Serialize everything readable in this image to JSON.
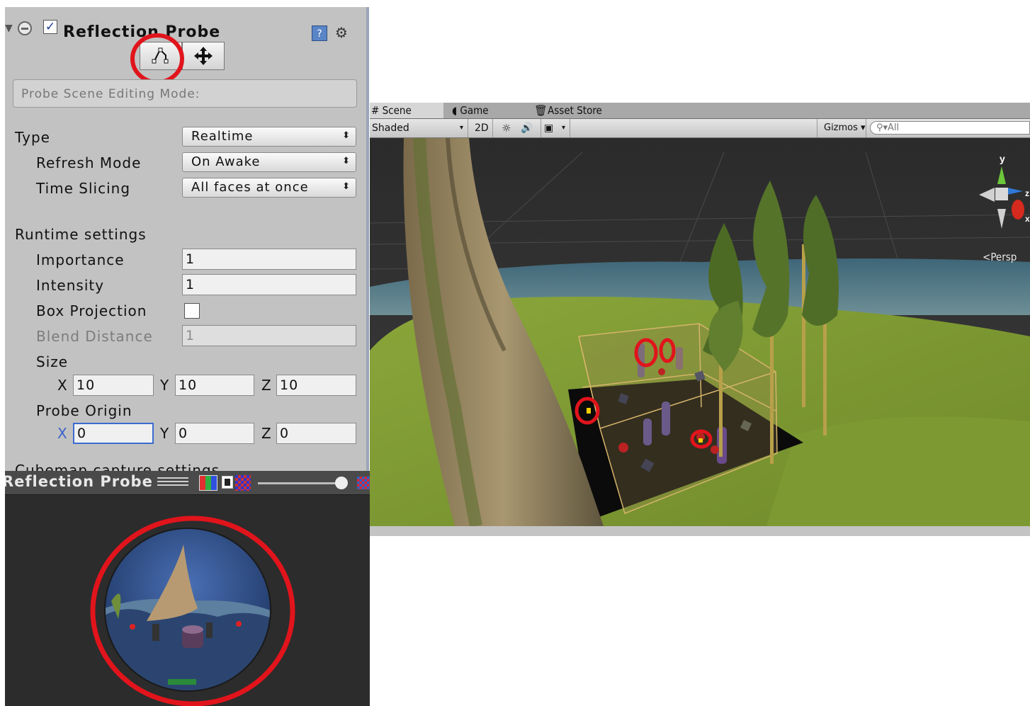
{
  "inspector": {
    "component_title": "Reflection Probe",
    "component_enabled": true,
    "edit_bounds_icon": "edit-bounds-icon",
    "move_origin_icon": "move-origin-icon",
    "mode_hint": "Probe Scene Editing Mode:",
    "type_label": "Type",
    "type_value": "Realtime",
    "refresh_mode_label": "Refresh Mode",
    "refresh_mode_value": "On Awake",
    "time_slicing_label": "Time Slicing",
    "time_slicing_value": "All faces at once",
    "runtime_settings_label": "Runtime settings",
    "importance_label": "Importance",
    "importance_value": "1",
    "intensity_label": "Intensity",
    "intensity_value": "1",
    "box_projection_label": "Box Projection",
    "box_projection_checked": false,
    "blend_distance_label": "Blend Distance",
    "blend_distance_value": "1",
    "size_label": "Size",
    "size": {
      "x_label": "X",
      "x": "10",
      "y_label": "Y",
      "y": "10",
      "z_label": "Z",
      "z": "10"
    },
    "probe_origin_label": "Probe Origin",
    "probe_origin": {
      "x_label": "X",
      "x": "0",
      "y_label": "Y",
      "y": "0",
      "z_label": "Z",
      "z": "0"
    },
    "cutoff_label": "Cubemap capture settings"
  },
  "preview": {
    "title": "Reflection Probe"
  },
  "scene": {
    "tabs": [
      {
        "icon": "grid-icon",
        "label": "Scene",
        "active": true
      },
      {
        "icon": "pacman-icon",
        "label": "Game",
        "active": false
      },
      {
        "icon": "store-icon",
        "label": "Asset Store",
        "active": false
      }
    ],
    "shading_mode": "Shaded",
    "toggle_2d": "2D",
    "gizmos_label": "Gizmos",
    "search_placeholder": "All",
    "axis_y": "y",
    "axis_z": "z",
    "axis_x": "x",
    "projection_label": "Persp"
  },
  "colors": {
    "annotation_red": "#e1141c",
    "editor_gray": "#c2c2c2",
    "probe_box": "#d6b46a"
  }
}
